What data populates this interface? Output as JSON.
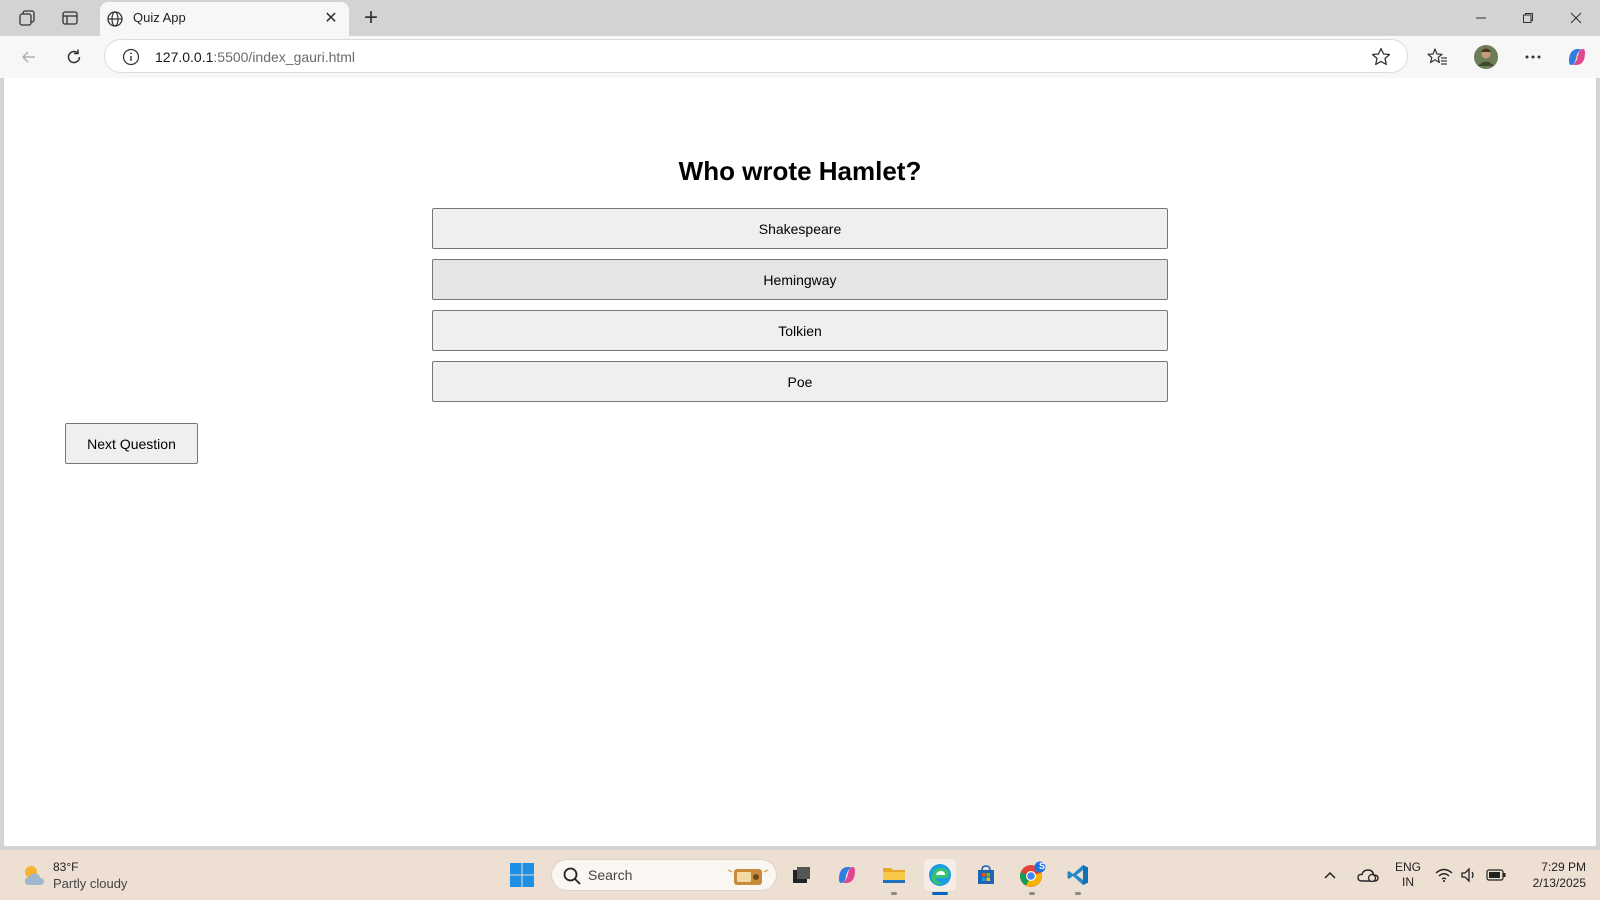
{
  "browser": {
    "tab_title": "Quiz App",
    "url_host": "127.0.0.1",
    "url_rest": ":5500/index_gauri.html"
  },
  "page": {
    "question": "Who wrote Hamlet?",
    "answers": [
      "Shakespeare",
      "Hemingway",
      "Tolkien",
      "Poe"
    ],
    "hovered_answer": "Hemingway",
    "next_label": "Next Question"
  },
  "taskbar": {
    "weather_temp": "83°F",
    "weather_desc": "Partly cloudy",
    "search_label": "Search",
    "apps": [
      "start-icon",
      "task-view-icon",
      "copilot-icon",
      "file-explorer-icon",
      "edge-icon",
      "store-icon",
      "chrome-icon",
      "vscode-icon"
    ],
    "chrome_badge": "S",
    "lang_line1": "ENG",
    "lang_line2": "IN",
    "time": "7:29 PM",
    "date": "2/13/2025"
  },
  "colors": {
    "accent": "#0067c0",
    "taskbar_bg": "#eedfd3",
    "tabstrip_bg": "#d3d3d3"
  }
}
